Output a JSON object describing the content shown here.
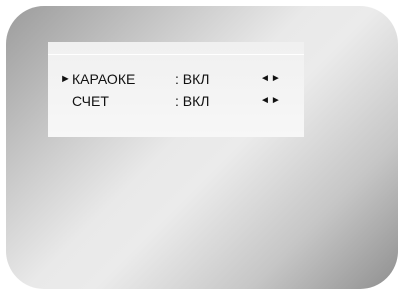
{
  "menu": {
    "items": [
      {
        "label": "КАРАОКЕ",
        "value": ": ВКЛ",
        "selected": true,
        "arrows": "◄►"
      },
      {
        "label": "СЧЕТ",
        "value": ": ВКЛ",
        "selected": false,
        "arrows": "◄►"
      }
    ],
    "cursor": "►"
  },
  "colors": {
    "panel": "#f4f4f4",
    "text": "#111111"
  }
}
